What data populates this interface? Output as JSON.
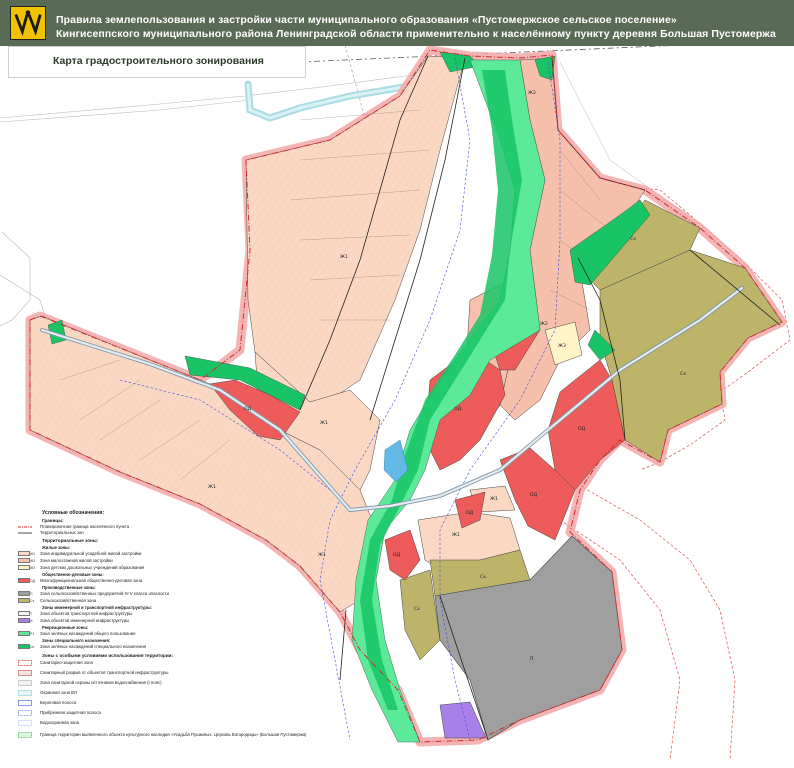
{
  "header": {
    "title_line_1": "Правила землепользования и застройки части муниципального образования «Пустомержское сельское поселение»",
    "title_line_2": "Кингисеппского муниципального района Ленинградской области применительно к населённому пункту деревня Большая Пустомержа",
    "subtitle": "Карта градостроительного зонирования",
    "band_color": "#5a6b55"
  },
  "colors": {
    "residential_individual": "#fbd8c3",
    "residential_multi": "#f6c0ad",
    "public_business": "#ee5b5b",
    "agricultural": "#bdb46a",
    "production": "#9f9f9f",
    "engineering": "#a880e8",
    "recreation": "#5cea9a",
    "special_green": "#18c466",
    "water": "#62b9e4",
    "boundary_pink": "#f2a7a7"
  },
  "zones": [
    {
      "code": "Ж1",
      "fill": "residential_individual",
      "label": "Ж1"
    },
    {
      "code": "Ж1",
      "fill": "residential_individual",
      "label": "Ж1"
    },
    {
      "code": "Ж1",
      "fill": "residential_individual",
      "label": "Ж1"
    },
    {
      "code": "Ж1",
      "fill": "residential_individual",
      "label": "Ж1"
    },
    {
      "code": "Ж2",
      "fill": "residential_multi",
      "label": "Ж2"
    },
    {
      "code": "Ж3",
      "fill": "residential_multi",
      "label": "Ж3"
    },
    {
      "code": "Ж2",
      "fill": "residential_multi",
      "label": "Ж2"
    },
    {
      "code": "Ж1",
      "fill": "residential_individual",
      "label": "Ж1"
    },
    {
      "code": "Ж1",
      "fill": "residential_individual",
      "label": "Ж1"
    },
    {
      "code": "ОД",
      "fill": "public_business",
      "label": "ОД"
    },
    {
      "code": "ОД",
      "fill": "public_business",
      "label": "ОД"
    },
    {
      "code": "ОД",
      "fill": "public_business",
      "label": "ОД"
    },
    {
      "code": "ОД",
      "fill": "public_business",
      "label": "ОД"
    },
    {
      "code": "ОД",
      "fill": "public_business",
      "label": "ОД"
    },
    {
      "code": "ОД",
      "fill": "public_business",
      "label": "ОД"
    },
    {
      "code": "Сх",
      "fill": "agricultural",
      "label": "Сх"
    },
    {
      "code": "Сх",
      "fill": "agricultural",
      "label": "Сх"
    },
    {
      "code": "Сх",
      "fill": "agricultural",
      "label": "Сх"
    },
    {
      "code": "Сх",
      "fill": "agricultural",
      "label": "Сх"
    },
    {
      "code": "П",
      "fill": "production",
      "label": "П"
    },
    {
      "code": "И",
      "fill": "engineering",
      "label": ""
    }
  ],
  "legend": {
    "title": "Условные обозначения:",
    "boundaries_heading": "Границы:",
    "boundaries": [
      {
        "label": "Планировочная граница населённого пункта"
      },
      {
        "label": "Территориальных зон"
      }
    ],
    "territorial_heading": "Территориальные зоны:",
    "residential_heading": "Жилые зоны:",
    "residential": [
      {
        "code": "Ж1",
        "label": "Зона индивидуальной усадебной жилой застройки",
        "color": "#fbd8c3"
      },
      {
        "code": "Ж2",
        "label": "Зона малоэтажной жилой застройки",
        "color": "#f6c0ad"
      },
      {
        "code": "Ж3",
        "label": "Зона детских дошкольных учреждений образования",
        "color": "#fff3c8"
      }
    ],
    "public_heading": "Общественно-деловые зоны:",
    "public": [
      {
        "code": "ОД",
        "label": "Многофункциональная общественно-деловая зона",
        "color": "#ee5b5b"
      }
    ],
    "production_heading": "Производственные зоны:",
    "production": [
      {
        "code": "П",
        "label": "Зона сельскохозяйственных предприятий IV-V класса опасности",
        "color": "#9f9f9f"
      },
      {
        "code": "Сх",
        "label": "Сельскохозяйственная зона",
        "color": "#bdb46a"
      }
    ],
    "transport_heading": "Зоны инженерной и транспортной инфраструктуры:",
    "transport": [
      {
        "code": "Т",
        "label": "Зона объектов транспортной инфраструктуры",
        "color": "#f2f2f2"
      },
      {
        "code": "И",
        "label": "Зона объектов инженерной инфраструктуры",
        "color": "#a880e8"
      }
    ],
    "recreation_heading": "Рекреационные зоны:",
    "recreation": [
      {
        "code": "Р1",
        "label": "Зона зелёных насаждений общего пользования",
        "color": "#5cea9a"
      }
    ],
    "special_heading": "Зоны специального назначения:",
    "special": [
      {
        "code": "Сп",
        "label": "Зона зелёных насаждений специального назначения",
        "color": "#18c466"
      }
    ],
    "restrictions_heading": "Зоны с особыми условиями использования территории:",
    "restrictions": [
      {
        "label": "Санитарно-защитная зона"
      },
      {
        "label": "Санитарный разрыв от объектов транспортной инфраструктуры"
      },
      {
        "label": "Зона санитарной охраны источников водоснабжения (I пояс)"
      },
      {
        "label": "Охранная зона ВЛ"
      },
      {
        "label": "Береговая полоса"
      },
      {
        "label": "Прибрежная защитная полоса"
      },
      {
        "label": "Водоохранная зона"
      },
      {
        "label": "Граница территории выявленного объекта культурного наследия «Усадьба Пушкиных. Церковь Богородицы» (Большая Пустомержа)"
      }
    ]
  }
}
